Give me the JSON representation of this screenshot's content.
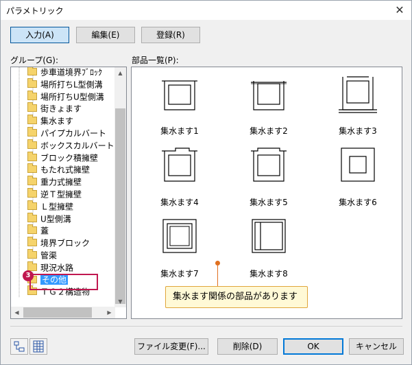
{
  "window": {
    "title": "パラメトリック",
    "close_glyph": "✕"
  },
  "tabs": [
    {
      "label": "入力(A)",
      "active": true
    },
    {
      "label": "編集(E)",
      "active": false
    },
    {
      "label": "登録(R)",
      "active": false
    }
  ],
  "group": {
    "label": "グループ(G):",
    "items": [
      "歩車道境界ﾌﾞﾛｯｸ",
      "場所打ちL型側溝",
      "場所打ちU型側溝",
      "街きょます",
      "集水ます",
      "パイプカルバート",
      "ボックスカルバート",
      "ブロック積擁壁",
      "もたれ式擁壁",
      "重力式擁壁",
      "逆Ｔ型擁壁",
      "Ｌ型擁壁",
      "U型側溝",
      "蓋",
      "境界ブロック",
      "管渠",
      "現況水路",
      "その他",
      "ＴＧ２構造物"
    ],
    "selected": "その他"
  },
  "parts": {
    "label": "部品一覧(P):",
    "items": [
      {
        "label": "集水ます1"
      },
      {
        "label": "集水ます2"
      },
      {
        "label": "集水ます3"
      },
      {
        "label": "集水ます4"
      },
      {
        "label": "集水ます5"
      },
      {
        "label": "集水ます6"
      },
      {
        "label": "集水ます7"
      },
      {
        "label": "集水ます8"
      }
    ]
  },
  "annotation": {
    "step_number": "3",
    "callout_text": "集水ます関係の部品があります",
    "highlight_color": "#c0174f",
    "callout_color": "#e07020"
  },
  "footer": {
    "file_change_label": "ファイル変更(F)...",
    "delete_label": "削除(D)",
    "ok_label": "OK",
    "cancel_label": "キャンセル"
  },
  "colors": {
    "selection": "#3399ff",
    "folder": "#f5d36b",
    "active_tab": "#cce4f7"
  }
}
